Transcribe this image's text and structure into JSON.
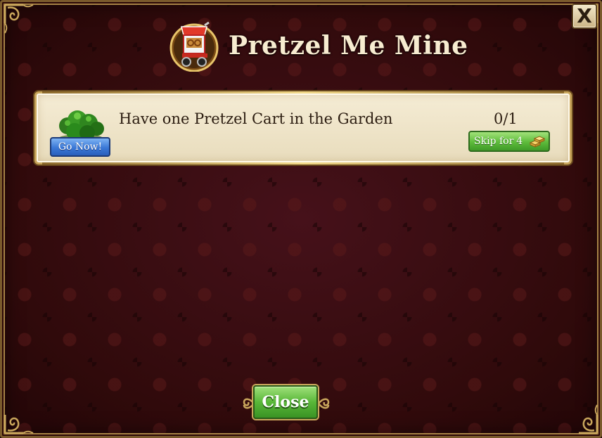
{
  "dialog": {
    "title": "Pretzel Me Mine",
    "title_icon": "pretzel-cart-icon",
    "close_x_label": "X"
  },
  "goals": [
    {
      "icon": "bush-icon",
      "go_now_label": "Go Now!",
      "text": "Have one Pretzel Cart in the Garden",
      "progress": "0/1",
      "skip_label": "Skip for",
      "skip_cost": "4",
      "skip_currency_icon": "gold-bars-icon"
    }
  ],
  "footer": {
    "close_label": "Close"
  },
  "colors": {
    "background": "#3a0d0e",
    "panel": "#f0e5c8",
    "gold_trim": "#c9a65c",
    "blue_button": "#3a78d6",
    "green_button": "#59b738"
  }
}
